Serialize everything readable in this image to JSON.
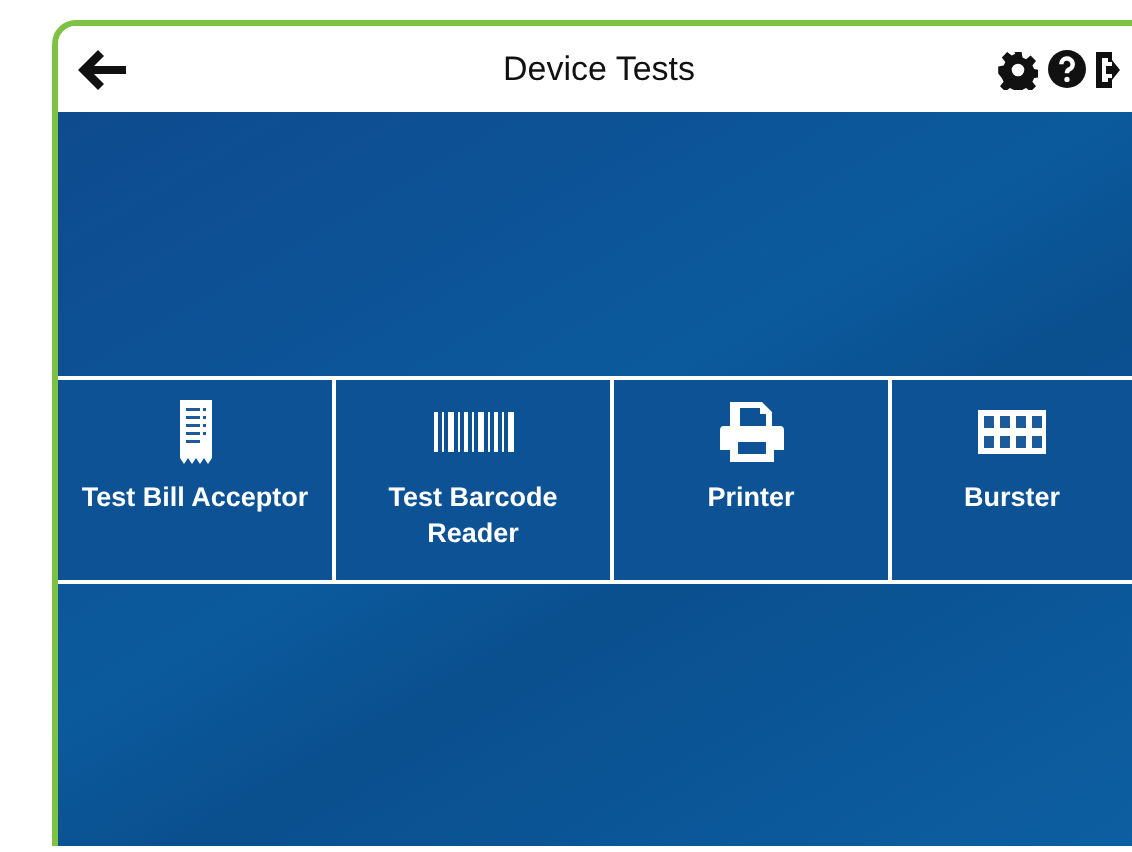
{
  "header": {
    "title": "Device Tests"
  },
  "tiles": [
    {
      "kind": "receipt",
      "label": "Test Bill Acceptor"
    },
    {
      "kind": "barcode",
      "label": "Test Barcode Reader"
    },
    {
      "kind": "printer",
      "label": "Printer"
    },
    {
      "kind": "grid",
      "label": "Burster"
    }
  ]
}
